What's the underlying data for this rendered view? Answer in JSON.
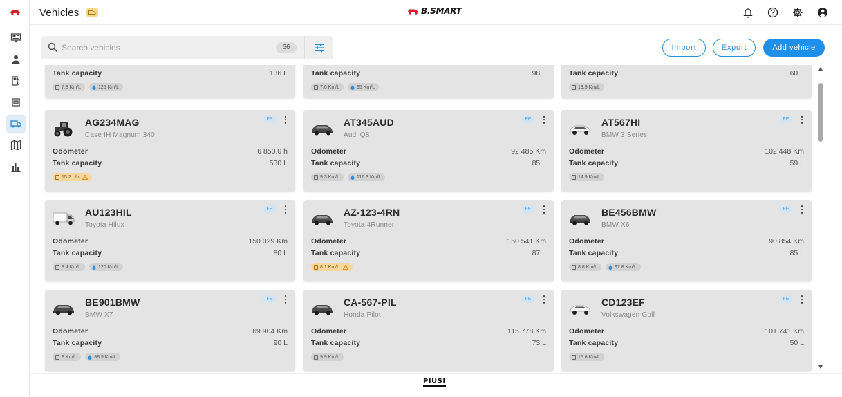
{
  "header": {
    "title": "Vehicles",
    "brand": "B.SMART"
  },
  "toolbar": {
    "search_placeholder": "Search vehicles",
    "count": "66",
    "import_label": "Import",
    "export_label": "Export",
    "add_label": "Add vehicle"
  },
  "sidebar": {
    "items": [
      "dashboard-icon",
      "user-icon",
      "fuel-pump-icon",
      "tank-icon",
      "vehicle-icon",
      "map-icon",
      "chart-icon"
    ],
    "active": "vehicle-icon"
  },
  "partial_cards": [
    {
      "tank_label": "Tank capacity",
      "tank": "136 L",
      "chips": [
        {
          "text": "7.8 Km/L",
          "type": "fuel"
        },
        {
          "text": "125 Km/L",
          "type": "drop"
        }
      ]
    },
    {
      "tank_label": "Tank capacity",
      "tank": "98 L",
      "chips": [
        {
          "text": "7.6 Km/L",
          "type": "fuel"
        },
        {
          "text": "95 Km/L",
          "type": "drop"
        }
      ]
    },
    {
      "tank_label": "Tank capacity",
      "tank": "60 L",
      "chips": [
        {
          "text": "13.9 Km/L",
          "type": "fuel"
        }
      ]
    }
  ],
  "vehicles": [
    {
      "plate": "AG234MAG",
      "model": "Case IH Magnum 340",
      "kind": "tractor",
      "tag": "FE",
      "odometer_label": "Odometer",
      "odometer": "6 850.0 h",
      "tank_label": "Tank capacity",
      "tank": "530 L",
      "chips": [
        {
          "text": "15.2 L/h",
          "type": "fuel",
          "warn": true
        }
      ]
    },
    {
      "plate": "AT345AUD",
      "model": "Audi Q8",
      "kind": "suv-dark",
      "tag": "FE",
      "odometer_label": "Odometer",
      "odometer": "92 485 Km",
      "tank_label": "Tank capacity",
      "tank": "85 L",
      "chips": [
        {
          "text": "9.3 Km/L",
          "type": "fuel"
        },
        {
          "text": "116.3 Km/L",
          "type": "drop"
        }
      ]
    },
    {
      "plate": "AT567HI",
      "model": "BMW 3 Series",
      "kind": "car-white",
      "tag": "FE",
      "odometer_label": "Odometer",
      "odometer": "102 448 Km",
      "tank_label": "Tank capacity",
      "tank": "59 L",
      "chips": [
        {
          "text": "14.9 Km/L",
          "type": "fuel"
        }
      ]
    },
    {
      "plate": "AU123HIL",
      "model": "Toyota Hilux",
      "kind": "truck",
      "tag": "FE",
      "odometer_label": "Odometer",
      "odometer": "150 029 Km",
      "tank_label": "Tank capacity",
      "tank": "80 L",
      "chips": [
        {
          "text": "8.4 Km/L",
          "type": "fuel"
        },
        {
          "text": "120 Km/L",
          "type": "drop"
        }
      ]
    },
    {
      "plate": "AZ-123-4RN",
      "model": "Toyota 4Runner",
      "kind": "suv-dark",
      "tag": "FE",
      "odometer_label": "Odometer",
      "odometer": "150 541 Km",
      "tank_label": "Tank capacity",
      "tank": "87 L",
      "chips": [
        {
          "text": "8.1 Km/L",
          "type": "fuel",
          "warn": true
        }
      ]
    },
    {
      "plate": "BE456BMW",
      "model": "BMW X6",
      "kind": "suv-dark",
      "tag": "FE",
      "odometer_label": "Odometer",
      "odometer": "90 854 Km",
      "tank_label": "Tank capacity",
      "tank": "85 L",
      "chips": [
        {
          "text": "8.8 Km/L",
          "type": "fuel"
        },
        {
          "text": "97.8 Km/L",
          "type": "drop"
        }
      ]
    },
    {
      "plate": "BE901BMW",
      "model": "BMW X7",
      "kind": "suv-dark",
      "tag": "FE",
      "odometer_label": "Odometer",
      "odometer": "69 904 Km",
      "tank_label": "Tank capacity",
      "tank": "90 L",
      "chips": [
        {
          "text": "8 Km/L",
          "type": "fuel"
        },
        {
          "text": "88.9 Km/L",
          "type": "drop"
        }
      ]
    },
    {
      "plate": "CA-567-PIL",
      "model": "Honda Pilot",
      "kind": "suv-dark",
      "tag": "FE",
      "odometer_label": "Odometer",
      "odometer": "115 778 Km",
      "tank_label": "Tank capacity",
      "tank": "73 L",
      "chips": [
        {
          "text": "9.9 Km/L",
          "type": "fuel"
        }
      ]
    },
    {
      "plate": "CD123EF",
      "model": "Volkswagen Golf",
      "kind": "car-white",
      "tag": "FE",
      "odometer_label": "Odometer",
      "odometer": "101 741 Km",
      "tank_label": "Tank capacity",
      "tank": "50 L",
      "chips": [
        {
          "text": "15.6 Km/L",
          "type": "fuel"
        }
      ]
    }
  ],
  "footer": {
    "logo": "PIUSI"
  },
  "colors": {
    "accent": "#1e90ea",
    "card_bg": "#e4e4e4",
    "warn": "#f7d7a0",
    "active_nav": "#dcecf8"
  }
}
